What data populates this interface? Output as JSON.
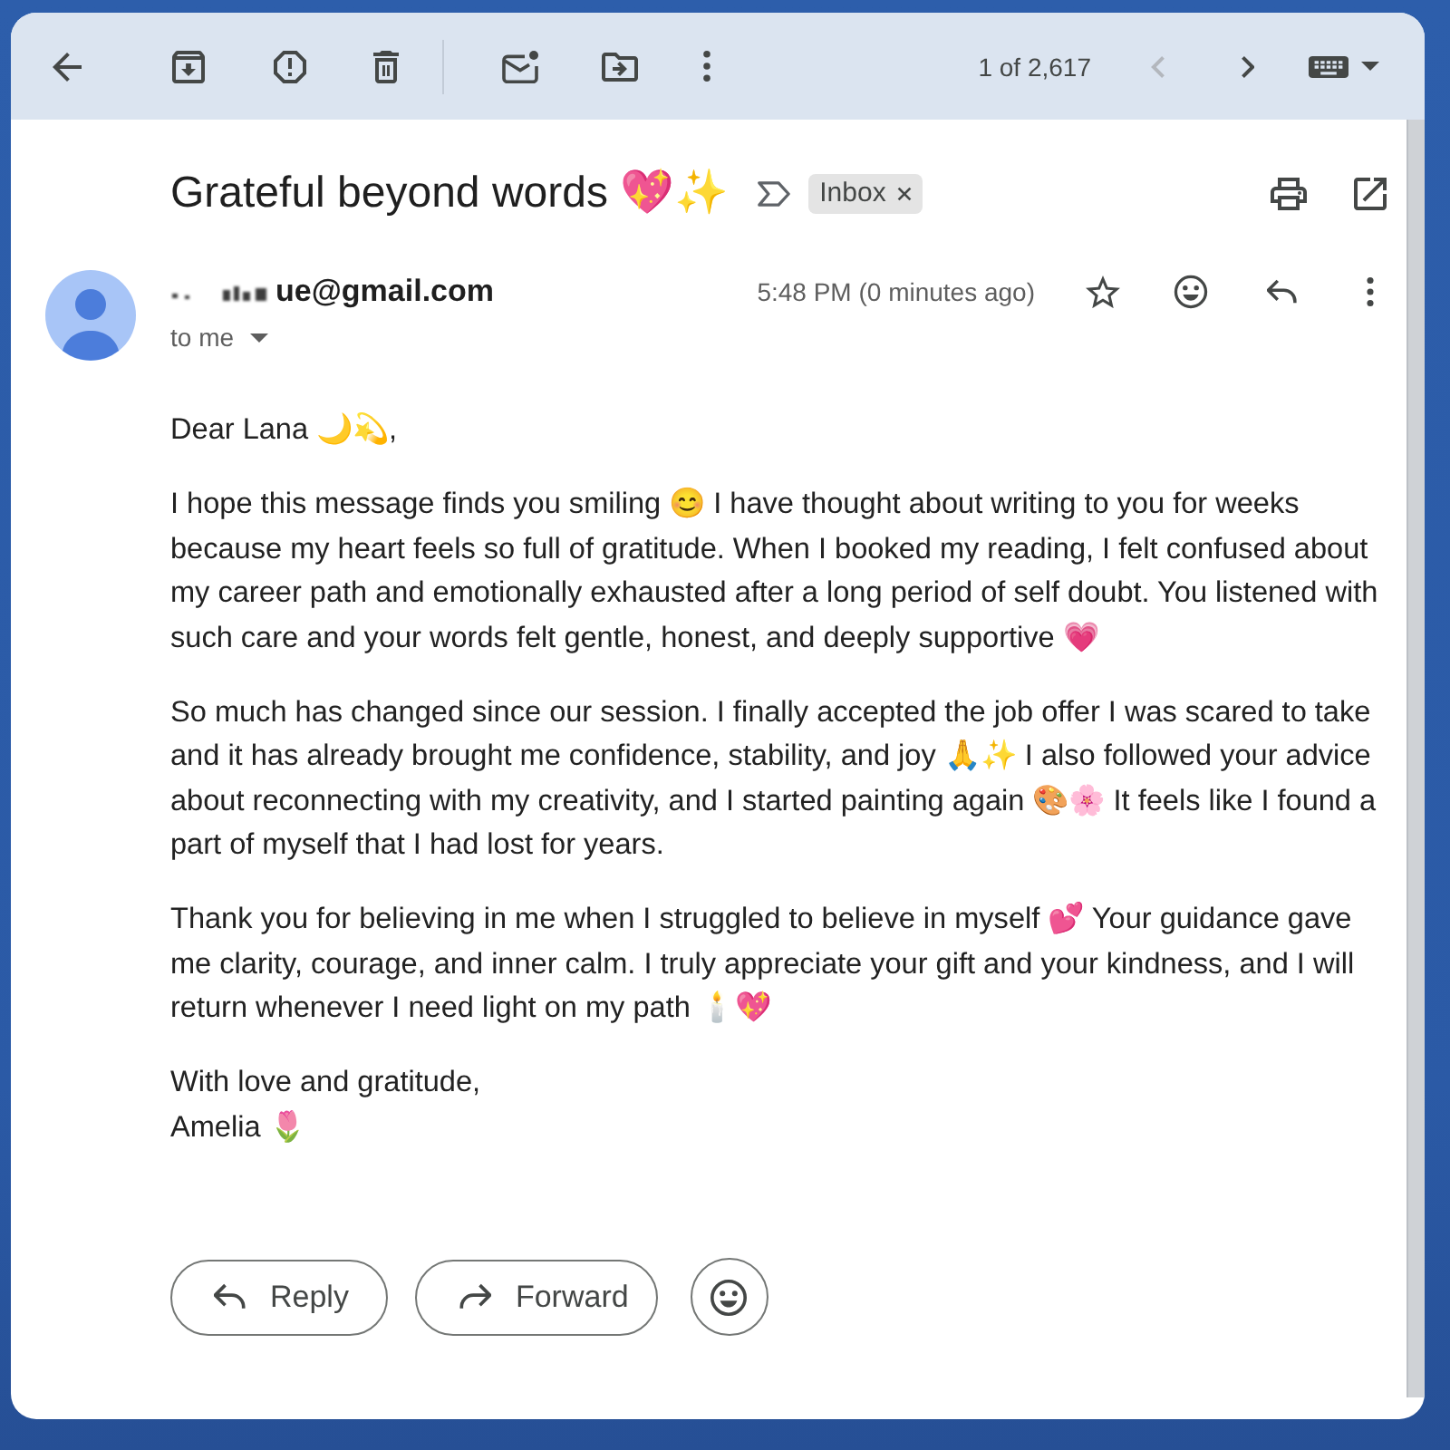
{
  "toolbar": {
    "pager": {
      "counter": "1 of 2,617",
      "previous": {
        "disabled": true
      },
      "next": {
        "disabled": false
      }
    }
  },
  "subject": {
    "title": "Grateful beyond words 💖✨",
    "important": false,
    "labels": [
      {
        "label": "Inbox"
      }
    ]
  },
  "sender": {
    "name": "ue@gmail.com",
    "time": "5:48 PM (0 minutes ago)",
    "recipient": "to me",
    "starred": false
  },
  "body": {
    "greeting": "Dear Lana 🌙💫,",
    "paragraphs": [
      "I hope this message finds you smiling 😊 I have thought about writing to you for weeks because my heart feels so full of gratitude. When I booked my reading, I felt confused about my career path and emotionally exhausted after a long period of self doubt. You listened with such care and your words felt gentle, honest, and deeply supportive 💗",
      "So much has changed since our session. I finally accepted the job offer I was scared to take and it has already brought me confidence, stability, and joy 🙏✨ I also followed your advice about reconnecting with my creativity, and I started painting again 🎨🌸 It feels like I found a part of myself that I had lost for years.",
      "Thank you for believing in me when I struggled to believe in myself 💕 Your guidance gave me clarity, courage, and inner calm. I truly appreciate your gift and your kindness, and I will return whenever I need light on my path 🕯️💖"
    ],
    "closing": "With love and gratitude,",
    "signature": "Amelia 🌷"
  },
  "actions": [
    {
      "kind": "reply",
      "label": "Reply"
    },
    {
      "kind": "forward",
      "label": "Forward"
    }
  ]
}
